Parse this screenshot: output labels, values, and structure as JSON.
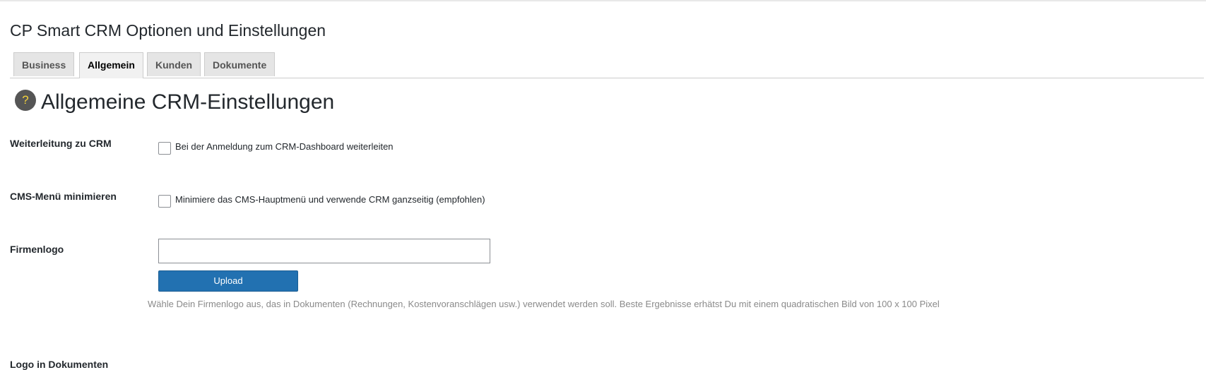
{
  "page": {
    "title": "CP Smart CRM Optionen und Einstellungen"
  },
  "tabs": [
    {
      "label": "Business",
      "active": false
    },
    {
      "label": "Allgemein",
      "active": true
    },
    {
      "label": "Kunden",
      "active": false
    },
    {
      "label": "Dokumente",
      "active": false
    }
  ],
  "section": {
    "help_icon": "?",
    "title": "Allgemeine CRM-Einstellungen"
  },
  "settings": {
    "redirect": {
      "label": "Weiterleitung zu CRM",
      "checkbox_text": "Bei der Anmeldung zum CRM-Dashboard weiterleiten",
      "checked": false
    },
    "minimize_menu": {
      "label": "CMS-Menü minimieren",
      "checkbox_text": "Minimiere das CMS-Hauptmenü und verwende CRM ganzseitig (empfohlen)",
      "checked": false
    },
    "logo": {
      "label": "Firmenlogo",
      "value": "",
      "upload_label": "Upload",
      "description": "Wähle Dein Firmenlogo aus, das in Dokumenten (Rechnungen, Kostenvoranschlägen usw.) verwendet werden soll. Beste Ergebnisse erhätst Du mit einem quadratischen Bild von 100 x 100 Pixel"
    },
    "next": {
      "label": "Logo in Dokumenten"
    }
  },
  "colors": {
    "accent": "#2271b1",
    "help_bg": "#555555",
    "help_fg": "#f5d33b"
  }
}
